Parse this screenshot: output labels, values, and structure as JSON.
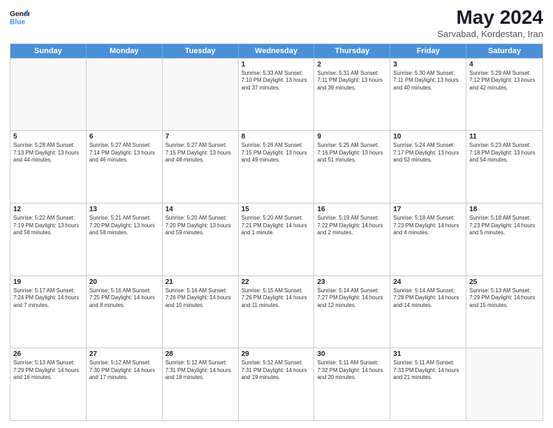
{
  "logo": {
    "line1": "General",
    "line2": "Blue"
  },
  "title": "May 2024",
  "subtitle": "Sarvabad, Kordestan, Iran",
  "days_of_week": [
    "Sunday",
    "Monday",
    "Tuesday",
    "Wednesday",
    "Thursday",
    "Friday",
    "Saturday"
  ],
  "weeks": [
    [
      {
        "day": "",
        "info": ""
      },
      {
        "day": "",
        "info": ""
      },
      {
        "day": "",
        "info": ""
      },
      {
        "day": "1",
        "info": "Sunrise: 5:33 AM\nSunset: 7:10 PM\nDaylight: 13 hours and 37 minutes."
      },
      {
        "day": "2",
        "info": "Sunrise: 5:31 AM\nSunset: 7:11 PM\nDaylight: 13 hours and 39 minutes."
      },
      {
        "day": "3",
        "info": "Sunrise: 5:30 AM\nSunset: 7:11 PM\nDaylight: 13 hours and 40 minutes."
      },
      {
        "day": "4",
        "info": "Sunrise: 5:29 AM\nSunset: 7:12 PM\nDaylight: 13 hours and 42 minutes."
      }
    ],
    [
      {
        "day": "5",
        "info": "Sunrise: 5:28 AM\nSunset: 7:13 PM\nDaylight: 13 hours and 44 minutes."
      },
      {
        "day": "6",
        "info": "Sunrise: 5:27 AM\nSunset: 7:14 PM\nDaylight: 13 hours and 46 minutes."
      },
      {
        "day": "7",
        "info": "Sunrise: 5:27 AM\nSunset: 7:15 PM\nDaylight: 13 hours and 48 minutes."
      },
      {
        "day": "8",
        "info": "Sunrise: 5:26 AM\nSunset: 7:15 PM\nDaylight: 13 hours and 49 minutes."
      },
      {
        "day": "9",
        "info": "Sunrise: 5:25 AM\nSunset: 7:16 PM\nDaylight: 13 hours and 51 minutes."
      },
      {
        "day": "10",
        "info": "Sunrise: 5:24 AM\nSunset: 7:17 PM\nDaylight: 13 hours and 53 minutes."
      },
      {
        "day": "11",
        "info": "Sunrise: 5:23 AM\nSunset: 7:18 PM\nDaylight: 13 hours and 54 minutes."
      }
    ],
    [
      {
        "day": "12",
        "info": "Sunrise: 5:22 AM\nSunset: 7:19 PM\nDaylight: 13 hours and 56 minutes."
      },
      {
        "day": "13",
        "info": "Sunrise: 5:21 AM\nSunset: 7:20 PM\nDaylight: 13 hours and 58 minutes."
      },
      {
        "day": "14",
        "info": "Sunrise: 5:20 AM\nSunset: 7:20 PM\nDaylight: 13 hours and 59 minutes."
      },
      {
        "day": "15",
        "info": "Sunrise: 5:20 AM\nSunset: 7:21 PM\nDaylight: 14 hours and 1 minute."
      },
      {
        "day": "16",
        "info": "Sunrise: 5:19 AM\nSunset: 7:22 PM\nDaylight: 14 hours and 2 minutes."
      },
      {
        "day": "17",
        "info": "Sunrise: 5:18 AM\nSunset: 7:23 PM\nDaylight: 14 hours and 4 minutes."
      },
      {
        "day": "18",
        "info": "Sunrise: 5:18 AM\nSunset: 7:23 PM\nDaylight: 14 hours and 5 minutes."
      }
    ],
    [
      {
        "day": "19",
        "info": "Sunrise: 5:17 AM\nSunset: 7:24 PM\nDaylight: 14 hours and 7 minutes."
      },
      {
        "day": "20",
        "info": "Sunrise: 5:16 AM\nSunset: 7:25 PM\nDaylight: 14 hours and 8 minutes."
      },
      {
        "day": "21",
        "info": "Sunrise: 5:16 AM\nSunset: 7:26 PM\nDaylight: 14 hours and 10 minutes."
      },
      {
        "day": "22",
        "info": "Sunrise: 5:15 AM\nSunset: 7:26 PM\nDaylight: 14 hours and 11 minutes."
      },
      {
        "day": "23",
        "info": "Sunrise: 5:14 AM\nSunset: 7:27 PM\nDaylight: 14 hours and 12 minutes."
      },
      {
        "day": "24",
        "info": "Sunrise: 5:14 AM\nSunset: 7:28 PM\nDaylight: 14 hours and 14 minutes."
      },
      {
        "day": "25",
        "info": "Sunrise: 5:13 AM\nSunset: 7:29 PM\nDaylight: 14 hours and 15 minutes."
      }
    ],
    [
      {
        "day": "26",
        "info": "Sunrise: 5:13 AM\nSunset: 7:29 PM\nDaylight: 14 hours and 16 minutes."
      },
      {
        "day": "27",
        "info": "Sunrise: 5:12 AM\nSunset: 7:30 PM\nDaylight: 14 hours and 17 minutes."
      },
      {
        "day": "28",
        "info": "Sunrise: 5:12 AM\nSunset: 7:31 PM\nDaylight: 14 hours and 18 minutes."
      },
      {
        "day": "29",
        "info": "Sunrise: 5:12 AM\nSunset: 7:31 PM\nDaylight: 14 hours and 19 minutes."
      },
      {
        "day": "30",
        "info": "Sunrise: 5:11 AM\nSunset: 7:32 PM\nDaylight: 14 hours and 20 minutes."
      },
      {
        "day": "31",
        "info": "Sunrise: 5:11 AM\nSunset: 7:33 PM\nDaylight: 14 hours and 21 minutes."
      },
      {
        "day": "",
        "info": ""
      }
    ]
  ]
}
